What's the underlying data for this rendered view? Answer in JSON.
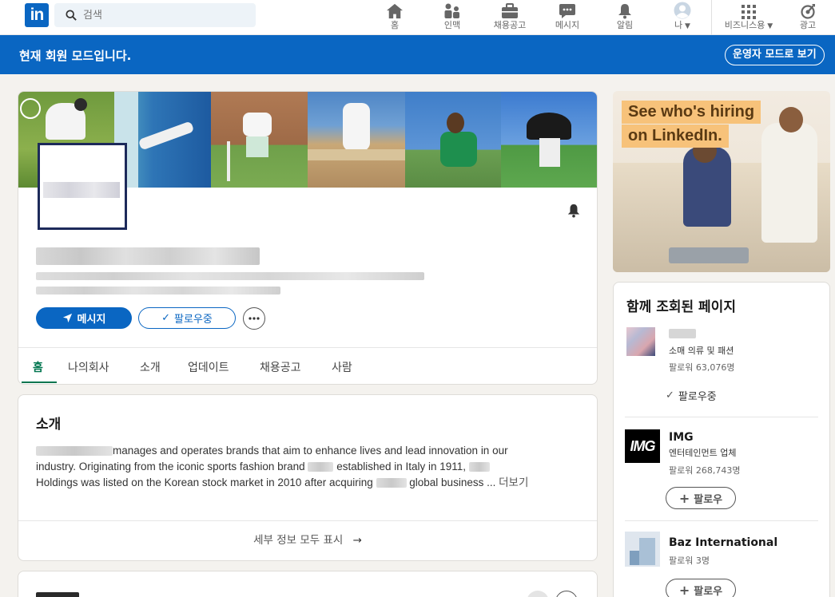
{
  "nav": {
    "logo": "in",
    "search_placeholder": "검색",
    "items": [
      {
        "label": "홈",
        "icon": "home-icon"
      },
      {
        "label": "인맥",
        "icon": "people-icon"
      },
      {
        "label": "채용공고",
        "icon": "briefcase-icon"
      },
      {
        "label": "메시지",
        "icon": "chat-icon"
      },
      {
        "label": "알림",
        "icon": "bell-icon"
      },
      {
        "label": "나",
        "icon": "avatar-icon"
      },
      {
        "label": "비즈니스용",
        "icon": "grid-icon"
      },
      {
        "label": "광고",
        "icon": "ads-icon"
      }
    ]
  },
  "banner": {
    "text": "현재 회원 모드입니다.",
    "button": "운영자 모드로 보기"
  },
  "profile": {
    "message_button": "메시지",
    "following_button": "팔로우중",
    "tabs": [
      "홈",
      "나의회사",
      "소개",
      "업데이트",
      "채용공고",
      "사람"
    ]
  },
  "about": {
    "title": "소개",
    "line1": "manages and operates brands that aim to enhance lives and lead innovation in our",
    "line2a": "industry. Originating from the iconic sports fashion brand",
    "line2b": "established in Italy in 1911,",
    "line3a": "Holdings was listed on the Korean stock market in 2010 after acquiring",
    "line3b": "global business ...",
    "more": "더보기",
    "show_all": "세부 정보 모두 표시"
  },
  "ad": {
    "line1": "See who's hiring",
    "line2": "on LinkedIn."
  },
  "similar": {
    "title": "함께 조회된 페이지",
    "pages": [
      {
        "name": "",
        "industry": "소매 의류 및 패션",
        "followers": "팔로워 63,076명",
        "button": "팔로우중"
      },
      {
        "name": "IMG",
        "industry": "엔터테인먼트 업체",
        "followers": "팔로워 268,743명",
        "button": "팔로우"
      },
      {
        "name": "Baz International",
        "industry": "",
        "followers": "팔로워 3명",
        "button": "팔로우"
      }
    ]
  },
  "colors": {
    "brand": "#0a66c2",
    "active_tab": "#01754f",
    "background": "#f4f2ee"
  }
}
